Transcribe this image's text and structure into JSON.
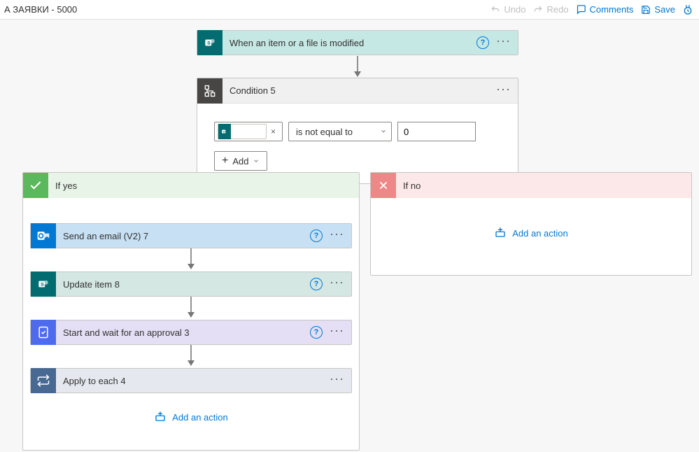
{
  "topbar": {
    "title_fragment": "А ЗАЯВКИ - 5000",
    "undo": "Undo",
    "redo": "Redo",
    "comments": "Comments",
    "save": "Save"
  },
  "trigger": {
    "label": "When an item or a file is modified"
  },
  "condition": {
    "title": "Condition 5",
    "operator": "is not equal to",
    "value": "0",
    "add_label": "Add"
  },
  "yes_branch": {
    "label": "If yes",
    "steps": [
      {
        "id": "send-email",
        "label": "Send an email (V2) 7",
        "bg": "#c7e0f4",
        "icon_bg": "#0078d4",
        "kind": "outlook",
        "has_help": true
      },
      {
        "id": "update-item",
        "label": "Update item 8",
        "bg": "#d4e7e3",
        "icon_bg": "#036c70",
        "kind": "sharepoint",
        "has_help": true
      },
      {
        "id": "approval",
        "label": "Start and wait for an approval 3",
        "bg": "#e4dff5",
        "icon_bg": "#4f6bed",
        "kind": "approval",
        "has_help": true
      },
      {
        "id": "apply-each",
        "label": "Apply to each 4",
        "bg": "#e5e9ef",
        "icon_bg": "#486991",
        "kind": "loop",
        "has_help": false
      }
    ],
    "add_action": "Add an action"
  },
  "no_branch": {
    "label": "If no",
    "add_action": "Add an action"
  }
}
